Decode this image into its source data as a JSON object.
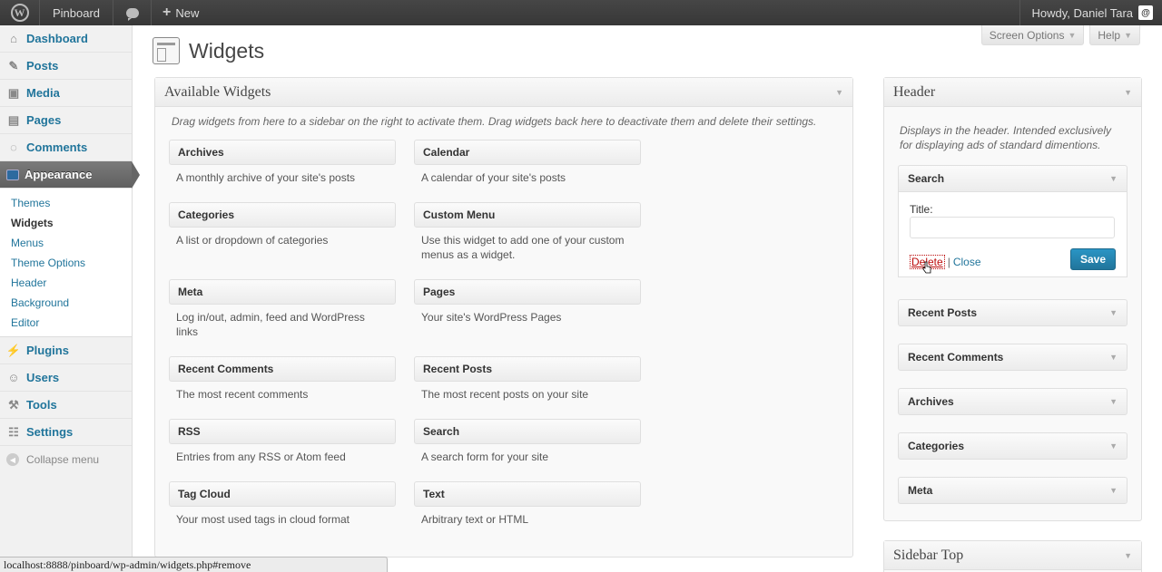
{
  "adminbar": {
    "site_name": "Pinboard",
    "new_label": "New",
    "howdy": "Howdy, Daniel Tara"
  },
  "menu": {
    "dashboard": "Dashboard",
    "posts": "Posts",
    "media": "Media",
    "pages": "Pages",
    "comments": "Comments",
    "appearance": "Appearance",
    "submenu": [
      "Themes",
      "Widgets",
      "Menus",
      "Theme Options",
      "Header",
      "Background",
      "Editor"
    ],
    "plugins": "Plugins",
    "users": "Users",
    "tools": "Tools",
    "settings": "Settings",
    "collapse": "Collapse menu"
  },
  "screen_options": "Screen Options",
  "help": "Help",
  "page_title": "Widgets",
  "available": {
    "title": "Available Widgets",
    "description": "Drag widgets from here to a sidebar on the right to activate them. Drag widgets back here to deactivate them and delete their settings.",
    "widgets": [
      {
        "title": "Archives",
        "desc": "A monthly archive of your site's posts"
      },
      {
        "title": "Calendar",
        "desc": "A calendar of your site's posts"
      },
      {
        "title": "Categories",
        "desc": "A list or dropdown of categories"
      },
      {
        "title": "Custom Menu",
        "desc": "Use this widget to add one of your custom menus as a widget."
      },
      {
        "title": "Meta",
        "desc": "Log in/out, admin, feed and WordPress links"
      },
      {
        "title": "Pages",
        "desc": "Your site's WordPress Pages"
      },
      {
        "title": "Recent Comments",
        "desc": "The most recent comments"
      },
      {
        "title": "Recent Posts",
        "desc": "The most recent posts on your site"
      },
      {
        "title": "RSS",
        "desc": "Entries from any RSS or Atom feed"
      },
      {
        "title": "Search",
        "desc": "A search form for your site"
      },
      {
        "title": "Tag Cloud",
        "desc": "Your most used tags in cloud format"
      },
      {
        "title": "Text",
        "desc": "Arbitrary text or HTML"
      }
    ]
  },
  "header_sidebar": {
    "title": "Header",
    "description": "Displays in the header. Intended exclusively for displaying ads of standard dimentions.",
    "search_widget": {
      "title": "Search",
      "field_label": "Title:",
      "field_value": "",
      "delete": "Delete",
      "separator": "|",
      "close": "Close",
      "save": "Save"
    },
    "widgets": [
      "Recent Posts",
      "Recent Comments",
      "Archives",
      "Categories",
      "Meta"
    ]
  },
  "sidebar_top": {
    "title": "Sidebar Top"
  },
  "status_url": "localhost:8888/pinboard/wp-admin/widgets.php#remove"
}
